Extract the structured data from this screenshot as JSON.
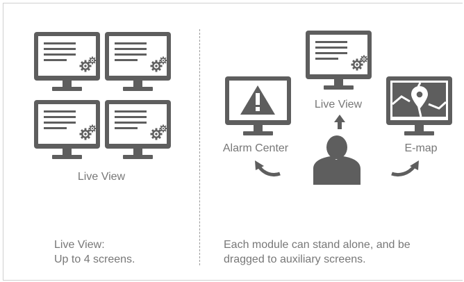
{
  "left_panel": {
    "caption": "Live View",
    "description_line1": "Live View:",
    "description_line2": "Up to 4 screens."
  },
  "right_panel": {
    "live_view_label": "Live View",
    "alarm_center_label": "Alarm Center",
    "emap_label": "E-map",
    "description_line1": "Each module can stand alone, and be",
    "description_line2": "dragged to auxiliary screens."
  },
  "colors": {
    "icon": "#5e5e5e",
    "text": "#777777",
    "border": "#cfcfcf"
  },
  "icons": [
    "monitor-icon",
    "gear-icon",
    "warning-icon",
    "map-pin-icon",
    "user-icon",
    "arrow-up-icon",
    "curved-arrow-icon"
  ]
}
